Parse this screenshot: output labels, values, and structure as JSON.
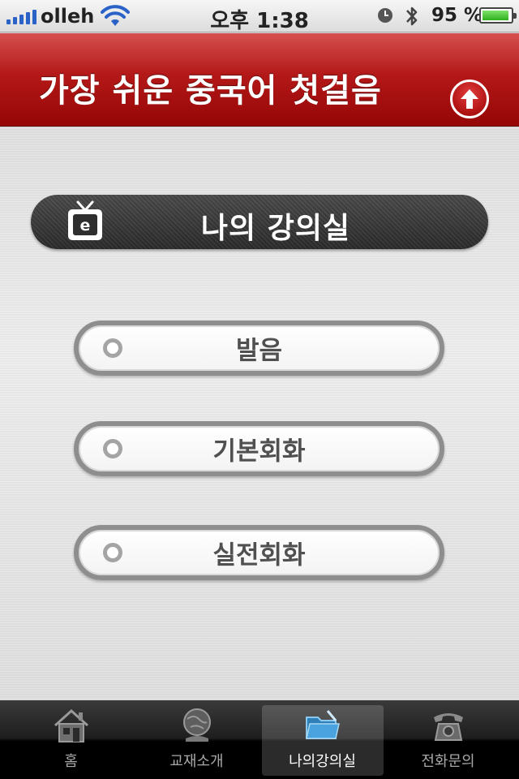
{
  "status_bar": {
    "carrier": "olleh",
    "time": "오후 1:38",
    "battery_percent": "95 %",
    "battery_level": 0.95,
    "icons": [
      "signal-icon",
      "wifi-icon",
      "alarm-icon",
      "bluetooth-icon",
      "battery-icon"
    ]
  },
  "header": {
    "title": "가장 쉬운 중국어 첫걸음",
    "up_icon": "arrow-up-circle-icon"
  },
  "section": {
    "title": "나의 강의실",
    "icon": "tv-icon"
  },
  "menu": {
    "items": [
      {
        "label": "발음"
      },
      {
        "label": "기본회화"
      },
      {
        "label": "실전회화"
      }
    ]
  },
  "tab_bar": {
    "active": "나의강의실",
    "tabs": [
      {
        "label": "홈",
        "icon": "home-icon"
      },
      {
        "label": "교재소개",
        "icon": "globe-icon"
      },
      {
        "label": "나의강의실",
        "icon": "folder-icon"
      },
      {
        "label": "전화문의",
        "icon": "phone-icon"
      }
    ]
  },
  "colors": {
    "header_red": "#b41818",
    "banner_dark": "#2f2f2f",
    "button_border": "#8e8e8e",
    "button_text": "#505050",
    "signal_blue": "#2a62c8",
    "battery_green": "#2fae1d"
  }
}
